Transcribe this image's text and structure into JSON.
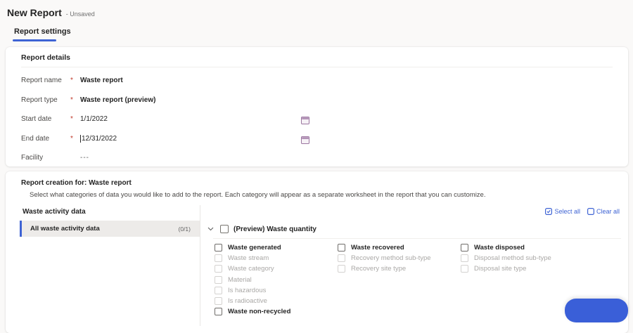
{
  "colors": {
    "accent": "#3e63d4",
    "button": "#3a5fd8",
    "required": "#c0392b"
  },
  "page": {
    "title": "New Report",
    "state": "- Unsaved"
  },
  "tabs": {
    "report_settings": "Report settings"
  },
  "required_marker": "*",
  "report_details": {
    "title": "Report details",
    "fields": [
      {
        "label": "Report name",
        "value": "Waste report"
      },
      {
        "label": "Report type",
        "value": "Waste report (preview)"
      },
      {
        "label": "Start date",
        "value": "1/1/2022"
      },
      {
        "label": "End date",
        "value": "12/31/2022"
      },
      {
        "label": "Facility",
        "value": "---"
      }
    ]
  },
  "report_creation": {
    "title": "Report creation for: Waste report",
    "description": "Select what categories of data you would like to add to the report. Each category will appear as a separate worksheet in the report that you can customize.",
    "select_all": "Select all",
    "clear_all": "Clear all",
    "left_panel": {
      "header": "Waste activity data",
      "items": [
        {
          "label": "All waste activity data",
          "count": "(0/1)"
        }
      ]
    },
    "group": {
      "label": "(Preview) Waste quantity"
    },
    "columns": [
      {
        "items": [
          {
            "label": "Waste generated"
          },
          {
            "label": "Waste stream"
          },
          {
            "label": "Waste category"
          },
          {
            "label": "Material"
          },
          {
            "label": "Is hazardous"
          },
          {
            "label": "Is radioactive"
          },
          {
            "label": "Waste non-recycled"
          }
        ]
      },
      {
        "items": [
          {
            "label": "Waste recovered"
          },
          {
            "label": "Recovery method sub-type"
          },
          {
            "label": "Recovery site type"
          }
        ]
      },
      {
        "items": [
          {
            "label": "Waste disposed"
          },
          {
            "label": "Disposal method sub-type"
          },
          {
            "label": "Disposal site type"
          }
        ]
      }
    ]
  }
}
